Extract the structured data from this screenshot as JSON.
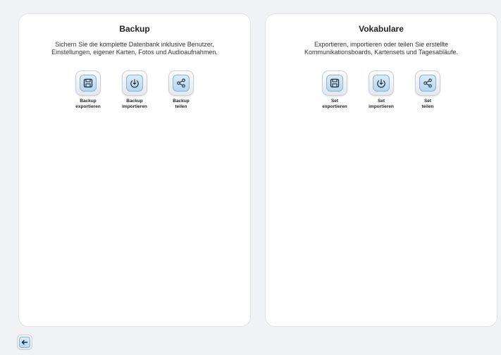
{
  "backup": {
    "title": "Backup",
    "description": "Sichern Sie die komplette Datenbank inklusive Benutzer,\nEinstellungen, eigener Karten, Fotos und Audioaufnahmen.",
    "actions": [
      {
        "label": "Backup\nexportieren",
        "icon": "save-icon"
      },
      {
        "label": "Backup\nimportieren",
        "icon": "download-icon"
      },
      {
        "label": "Backup\nteilen",
        "icon": "share-icon"
      }
    ]
  },
  "vocab": {
    "title": "Vokabulare",
    "description": "Exportieren, importieren oder teilen Sie erstellte\nKommunikationsboards, Kartensets und Tagesabläufe.",
    "actions": [
      {
        "label": "Set\nexportieren",
        "icon": "save-icon"
      },
      {
        "label": "Set\nimportieren",
        "icon": "download-icon"
      },
      {
        "label": "Set\nteilen",
        "icon": "share-icon"
      }
    ]
  },
  "nav": {
    "back_icon": "back-arrow-icon"
  },
  "colors": {
    "background": "#f1f2f5",
    "panel": "#ffffff",
    "icon_accent": "#b7d7ef",
    "icon_stroke": "#1f2f3f"
  }
}
